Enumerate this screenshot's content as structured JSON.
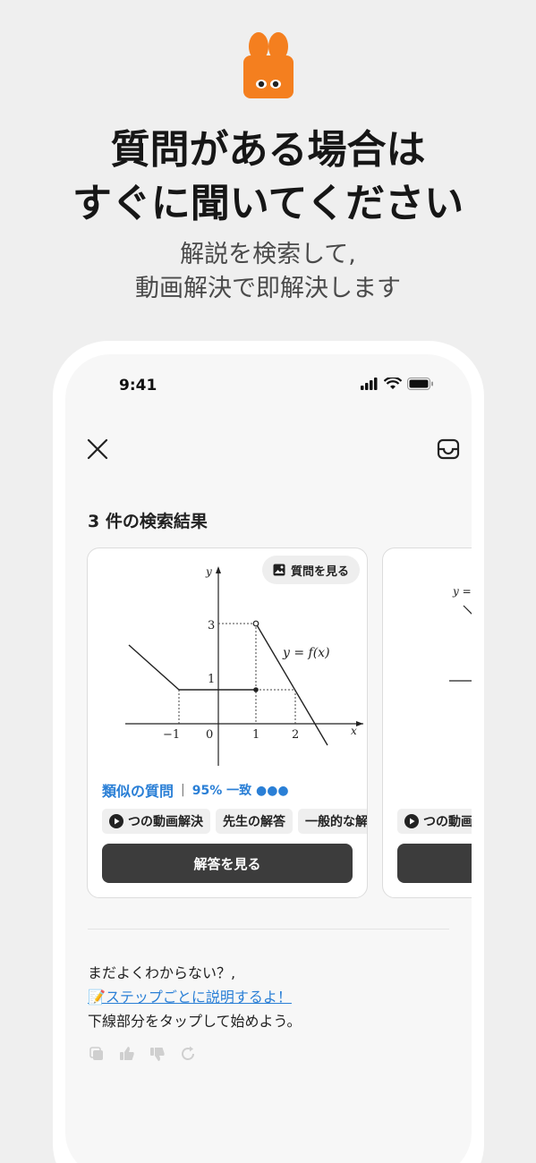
{
  "header": {
    "headline_line1": "質問がある場合は",
    "headline_line2": "すぐに聞いてください",
    "sub_line1": "解説を検索して,",
    "sub_line2": "動画解決で即解決します"
  },
  "status_bar": {
    "time": "9:41"
  },
  "results": {
    "title": "3 件の検索結果",
    "card": {
      "question_button": "質問を見る",
      "similar_label": "類似の質問",
      "match_text": "95% 一致 ●●●",
      "chips": [
        "つの動画解決",
        "先生の解答",
        "一般的な解"
      ],
      "answer_button": "解答を見る",
      "graph": {
        "y_axis": "y",
        "x_axis": "x",
        "function_label": "y = f(x)",
        "tick_labels": [
          "−1",
          "0",
          "1",
          "2",
          "1",
          "3"
        ]
      }
    },
    "card2": {
      "graph_label": "y =",
      "chip": "つの動画"
    }
  },
  "help": {
    "line1": "まだよくわからない？,",
    "link": "📝ステップごとに説明するよ！",
    "line3": "下線部分をタップして始めよう。"
  },
  "colors": {
    "accent": "#2a7fd6",
    "mascot": "#f47f1f",
    "button": "#3c3c3c"
  },
  "icons": [
    "close-icon",
    "inbox-icon",
    "image-icon",
    "play-icon",
    "copy-icon",
    "thumbs-up-icon",
    "thumbs-down-icon",
    "refresh-icon"
  ]
}
